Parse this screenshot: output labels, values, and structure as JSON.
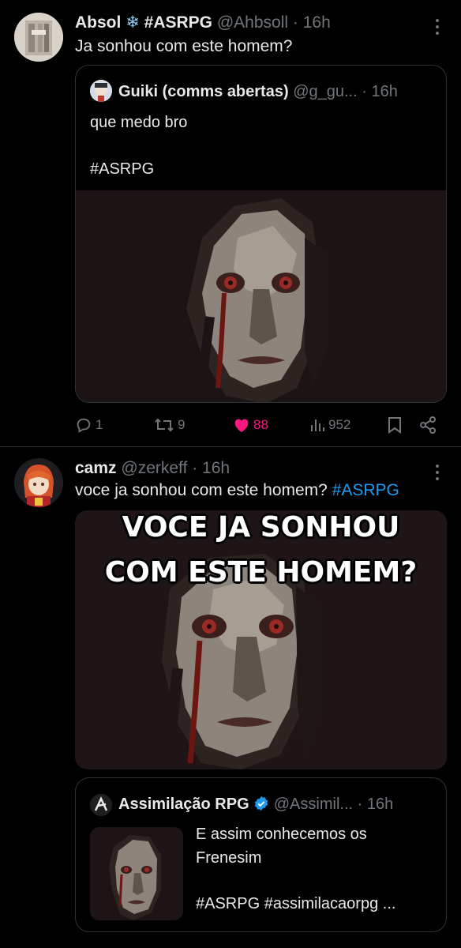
{
  "post1": {
    "author_name": "Absol",
    "author_emoji": "❄",
    "author_tag": "#ASRPG",
    "handle": "@Ahbsoll",
    "sep": "·",
    "time": "16h",
    "text": "Ja sonhou com este homem?",
    "quote": {
      "name": "Guiki (comms abertas)",
      "handle": "@g_gu...",
      "sep": "·",
      "time": "16h",
      "text_line1": "que medo bro",
      "text_line2": "#ASRPG"
    },
    "actions": {
      "replies": "1",
      "reposts": "9",
      "likes": "88",
      "views": "952"
    }
  },
  "post2": {
    "author_name": "camz",
    "handle": "@zerkeff",
    "sep": "·",
    "time": "16h",
    "text": "voce ja sonhou com este homem?",
    "hashtag": "#ASRPG",
    "meme_line1": "VOCE JA SONHOU",
    "meme_line2": "COM ESTE HOMEM?",
    "quote": {
      "name": "Assimilação RPG",
      "handle": "@Assimil...",
      "sep": "·",
      "time": "16h",
      "text_line1": "E assim conhecemos os",
      "text_line2": "Frenesim",
      "text_line3": "#ASRPG #assimilacaorpg ..."
    }
  },
  "colors": {
    "background": "#000000",
    "text": "#e7e9ea",
    "muted": "#71767b",
    "link": "#1d9bf0",
    "like": "#f91880",
    "verified": "#1d9bf0"
  },
  "icons": {
    "reply": "reply-icon",
    "repost": "repost-icon",
    "like": "heart-icon",
    "views": "views-icon",
    "bookmark": "bookmark-icon",
    "share": "share-icon",
    "more": "more-icon",
    "verified": "verified-badge-icon"
  }
}
